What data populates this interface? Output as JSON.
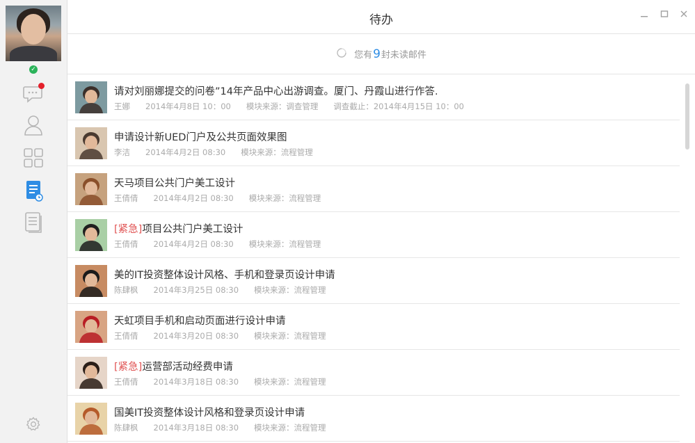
{
  "window": {
    "title": "待办",
    "minimize_icon": "minimize-icon",
    "maximize_icon": "maximize-icon",
    "close_icon": "close-icon"
  },
  "sidebar": {
    "items": [
      {
        "name": "chat",
        "icon": "chat-icon",
        "has_badge": true
      },
      {
        "name": "contacts",
        "icon": "contact-icon"
      },
      {
        "name": "apps",
        "icon": "apps-grid-icon"
      },
      {
        "name": "todo",
        "icon": "todo-doc-icon",
        "active": true
      },
      {
        "name": "documents",
        "icon": "document-icon"
      }
    ],
    "settings_icon": "gear-icon",
    "accent": "#2f8de4",
    "status_color": "#2bb35a"
  },
  "unread": {
    "prefix": "您有",
    "count": "9",
    "suffix": "封未读邮件"
  },
  "tasks": [
    {
      "urgent_tag": "",
      "title": "请对刘丽娜提交的问卷”14年产品中心出游调查。厦门、丹霞山进行作答.",
      "meta": [
        "王娜",
        "2014年4月8日  10：00",
        "模块来源：调查管理",
        "调查截止：2014年4月15日  10：00"
      ],
      "thumb": [
        "#7d9aa0",
        "#3b2f2a"
      ]
    },
    {
      "urgent_tag": "",
      "title": "申请设计新UED门户及公共页面效果图",
      "meta": [
        "李洁",
        "2014年4月2日  08:30",
        "模块来源：流程管理"
      ],
      "thumb": [
        "#d9c6b0",
        "#4a3a30"
      ]
    },
    {
      "urgent_tag": "",
      "title": "天马项目公共门户美工设计",
      "meta": [
        "王倩倩",
        "2014年4月2日  08:30",
        "模块来源：流程管理"
      ],
      "thumb": [
        "#c6a27e",
        "#8a4f2a"
      ]
    },
    {
      "urgent_tag": "[紧急]",
      "title": "项目公共门户美工设计",
      "meta": [
        "王倩倩",
        "2014年4月2日  08:30",
        "模块来源：流程管理"
      ],
      "thumb": [
        "#a9cfa5",
        "#1f1f1f"
      ]
    },
    {
      "urgent_tag": "",
      "title": "美的IT投资整体设计风格、手机和登录页设计申请",
      "meta": [
        "陈肆枫",
        "2014年3月25日  08:30",
        "模块来源：流程管理"
      ],
      "thumb": [
        "#c78b62",
        "#1a1a1a"
      ]
    },
    {
      "urgent_tag": "",
      "title": "天虹项目手机和启动页面进行设计申请",
      "meta": [
        "王倩倩",
        "2014年3月20日  08:30",
        "模块来源：流程管理"
      ],
      "thumb": [
        "#d8a483",
        "#b81d24"
      ]
    },
    {
      "urgent_tag": "[紧急]",
      "title": "运营部活动经费申请",
      "meta": [
        "王倩倩",
        "2014年3月18日  08:30",
        "模块来源：流程管理"
      ],
      "thumb": [
        "#e6d5c8",
        "#2a1e18"
      ]
    },
    {
      "urgent_tag": "",
      "title": "国美IT投资整体设计风格和登录页设计申请",
      "meta": [
        "陈肆枫",
        "2014年3月18日  08:30",
        "模块来源：流程管理"
      ],
      "thumb": [
        "#e8d3a8",
        "#b55a2a"
      ]
    }
  ]
}
